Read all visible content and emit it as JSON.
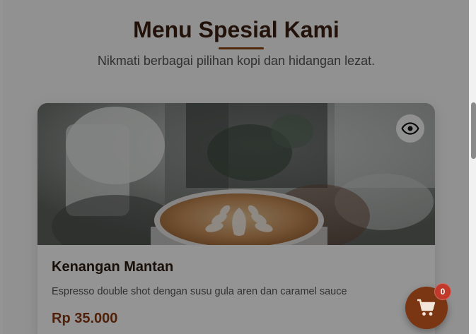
{
  "section": {
    "title": "Menu Spesial Kami",
    "subtitle": "Nikmati berbagai pilihan kopi dan hidangan lezat."
  },
  "menu": {
    "items": [
      {
        "name": "Kenangan Mantan",
        "description": "Espresso double shot dengan susu gula aren dan caramel sauce",
        "price": "Rp 35.000",
        "image_icon": "latte-art-photo",
        "quick_view_icon": "eye-icon"
      }
    ]
  },
  "cart": {
    "icon": "cart-icon",
    "count": "0"
  },
  "colors": {
    "accent": "#8b4513",
    "price": "#8b3a12",
    "cart_button": "#7a3512",
    "badge": "#c0392b"
  }
}
